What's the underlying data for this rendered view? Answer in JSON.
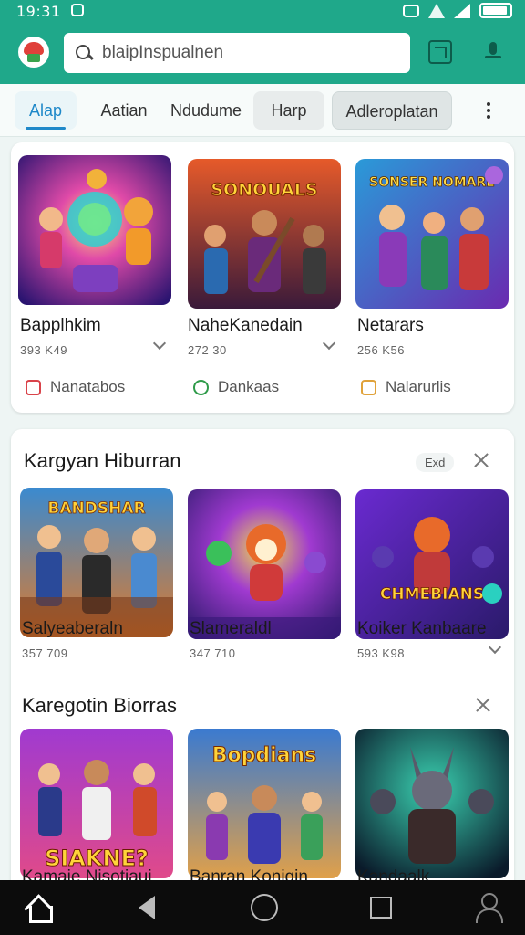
{
  "status_bar": {
    "time": "19:31"
  },
  "search": {
    "query": "blaipInspualnen"
  },
  "tabs": [
    "Alap",
    "Aatian",
    "Ndudume",
    "Harp",
    "Adleroplatan"
  ],
  "featured": [
    {
      "name": "Bapplhkim",
      "meta": "393 K49",
      "chip": "Nanatabos",
      "chip_color": "#d9434a"
    },
    {
      "name": "NaheKanedain",
      "meta": "272 30",
      "chip": "Dankaas",
      "chip_color": "#2f9b4a"
    },
    {
      "name": "Netarars",
      "meta": "256 K56",
      "chip": "Nalarurlis",
      "chip_color": "#e0a23a"
    }
  ],
  "sections": [
    {
      "title": "Kargyan Hiburran",
      "badge": "Exd",
      "apps": [
        {
          "name": "Salyeaberaln",
          "meta": "357 709"
        },
        {
          "name": "Slameraldl",
          "meta": "347 710"
        },
        {
          "name": "Koiker Kanbaare",
          "meta": "593 K98"
        }
      ]
    },
    {
      "title": "Karegotin Biorras",
      "apps": [
        {
          "name": "Kamaie Nisotiaui"
        },
        {
          "name": "Banran Konigin"
        },
        {
          "name": "Kandaalk"
        }
      ]
    }
  ],
  "thumb_titles": [
    "SONOUALS",
    "SONSER NOMARE",
    "BANDSHAR",
    "CHMEBIANS",
    "SIAKNE?",
    "Bopdians"
  ],
  "colors": {
    "accent_teal": "#1fa88a",
    "tab_active": "#1e88c9"
  }
}
